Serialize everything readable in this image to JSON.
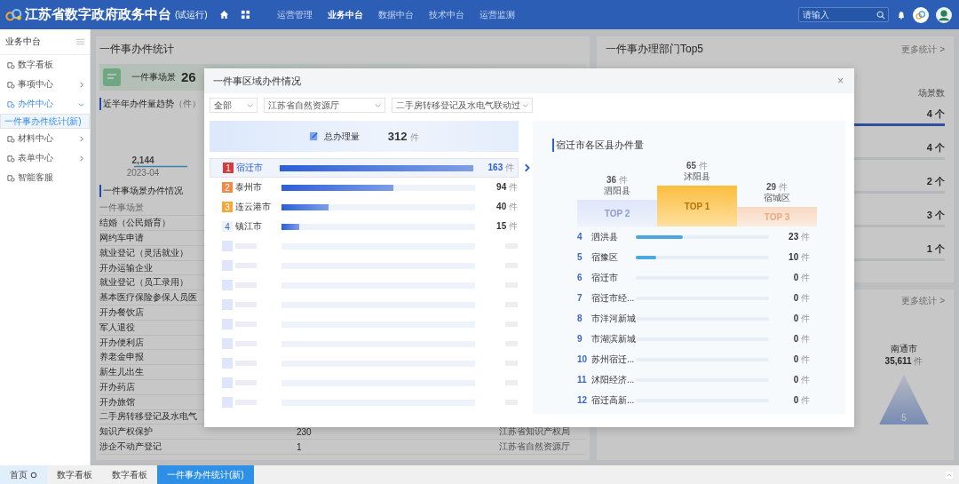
{
  "header": {
    "logo_text": "江苏省数字政府政务中台",
    "logo_suffix": "(试运行)",
    "nav": [
      {
        "label": "运营管理",
        "selected": false
      },
      {
        "label": "业务中台",
        "selected": true
      },
      {
        "label": "数据中台",
        "selected": false
      },
      {
        "label": "技术中台",
        "selected": false
      },
      {
        "label": "运营监测",
        "selected": false
      }
    ],
    "search": {
      "placeholder": "请输入"
    }
  },
  "sidebar": {
    "title": "业务中台",
    "items": [
      {
        "label": "数字看板",
        "kind": "leaf"
      },
      {
        "label": "事项中心",
        "kind": "group",
        "expanded": false
      },
      {
        "label": "办件中心",
        "kind": "group",
        "expanded": true,
        "children": [
          {
            "label": "一件事办件统计(新)",
            "selected": true
          }
        ]
      },
      {
        "label": "材料中心",
        "kind": "group",
        "expanded": false
      },
      {
        "label": "表单中心",
        "kind": "group",
        "expanded": false
      },
      {
        "label": "智能客服",
        "kind": "leaf"
      }
    ]
  },
  "stats_panel": {
    "title": "一件事办件统计",
    "scene_card": {
      "label": "一件事场景",
      "value": "26"
    },
    "trend": {
      "title": "近半年办件量趋势",
      "unit": "（件）",
      "value_label": "2,144",
      "x_label": "2023-04"
    },
    "scenes": {
      "title": "一件事场景办件情况",
      "column": "一件事场景",
      "rows": [
        {
          "name": "结婚（公民婚育）"
        },
        {
          "name": "网约车申请"
        },
        {
          "name": "就业登记（灵活就业）"
        },
        {
          "name": "开办运输企业"
        },
        {
          "name": "就业登记（员工录用）"
        },
        {
          "name": "基本医疗保险参保人员医"
        },
        {
          "name": "开办餐饮店"
        },
        {
          "name": "军人退役"
        },
        {
          "name": "开办便利店"
        },
        {
          "name": "养老金申报"
        },
        {
          "name": "新生儿出生"
        },
        {
          "name": "开办药店"
        },
        {
          "name": "开办旅馆"
        },
        {
          "name": "二手房转移登记及水电气"
        },
        {
          "name": "知识产权保护",
          "count": "230",
          "department": "江苏省知识产权局"
        },
        {
          "name": "涉企不动产登记",
          "count": "1",
          "department": "江苏省自然资源厅"
        }
      ]
    }
  },
  "dept_panel": {
    "title": "一件事办理部门Top5",
    "more": "更多统计 >",
    "column": "场景数",
    "rows": [
      {
        "value": "4 个",
        "selected": true
      },
      {
        "value": "4 个",
        "selected": false
      },
      {
        "value": "2 个",
        "selected": false
      },
      {
        "value": "3 个",
        "selected": false
      },
      {
        "value": "1 个",
        "selected": false
      }
    ]
  },
  "region_panel": {
    "more": "更多统计 >",
    "city": "南通市",
    "count": "35,611",
    "unit": "件",
    "rank": "5"
  },
  "modal": {
    "title": "一件事区域办件情况",
    "close": "×",
    "filters": [
      "全部",
      "江苏省自然资源厅",
      "二手房转移登记及水电气联动过"
    ],
    "total": {
      "label": "总办理量",
      "value": "312",
      "unit": "件"
    },
    "cities": [
      {
        "kind": "named",
        "rank": "1",
        "name": "宿迁市",
        "value": "163",
        "unit": "件",
        "level": 1,
        "selected": true
      },
      {
        "kind": "named",
        "rank": "2",
        "name": "泰州市",
        "value": "94",
        "unit": "件",
        "level": 0.577,
        "selected": false
      },
      {
        "kind": "named",
        "rank": "3",
        "name": "连云港市",
        "value": "40",
        "unit": "件",
        "level": 0.245,
        "selected": false
      },
      {
        "kind": "named",
        "rank": "4",
        "name": "镇江市",
        "value": "15",
        "unit": "件",
        "level": 0.092,
        "selected": false
      },
      {
        "kind": "blurred",
        "level": 0
      },
      {
        "kind": "blurred",
        "level": 0
      },
      {
        "kind": "blurred",
        "level": 0
      },
      {
        "kind": "blurred",
        "level": 0
      },
      {
        "kind": "blurred",
        "level": 0
      },
      {
        "kind": "blurred",
        "level": 0
      },
      {
        "kind": "blurred",
        "level": 0
      },
      {
        "kind": "blurred",
        "level": 0
      },
      {
        "kind": "blurred",
        "level": 0
      }
    ],
    "district_title": "宿迁市各区县办件量",
    "podium": [
      {
        "kind": "second",
        "label": "TOP 2",
        "value": "36",
        "unit": "件",
        "name": "泗阳县"
      },
      {
        "kind": "first",
        "label": "TOP 1",
        "value": "65",
        "unit": "件",
        "name": "沭阳县"
      },
      {
        "kind": "third",
        "label": "TOP 3",
        "value": "29",
        "unit": "件",
        "name": "宿城区"
      }
    ],
    "districts": [
      {
        "rank": "4",
        "name": "泗洪县",
        "value": "23",
        "unit": "件",
        "level": 0.354
      },
      {
        "rank": "5",
        "name": "宿豫区",
        "value": "10",
        "unit": "件",
        "level": 0.154
      },
      {
        "rank": "6",
        "name": "宿迁市",
        "value": "0",
        "unit": "件",
        "level": 0
      },
      {
        "rank": "7",
        "name": "宿迁市经...",
        "value": "0",
        "unit": "件",
        "level": 0
      },
      {
        "rank": "8",
        "name": "市洋河新城",
        "value": "0",
        "unit": "件",
        "level": 0
      },
      {
        "rank": "9",
        "name": "市湖滨新城",
        "value": "0",
        "unit": "件",
        "level": 0
      },
      {
        "rank": "10",
        "name": "苏州宿迁...",
        "value": "0",
        "unit": "件",
        "level": 0
      },
      {
        "rank": "11",
        "name": "沭阳经济...",
        "value": "0",
        "unit": "件",
        "level": 0
      },
      {
        "rank": "12",
        "name": "宿迁高新...",
        "value": "0",
        "unit": "件",
        "level": 0
      }
    ]
  },
  "footer_tabs": [
    {
      "label": "首页",
      "kind": "home",
      "selected": false
    },
    {
      "label": "数字看板",
      "kind": "page",
      "selected": false
    },
    {
      "label": "数字看板",
      "kind": "page",
      "selected": false
    },
    {
      "label": "一件事办件统计(新)",
      "kind": "page",
      "selected": true
    }
  ]
}
